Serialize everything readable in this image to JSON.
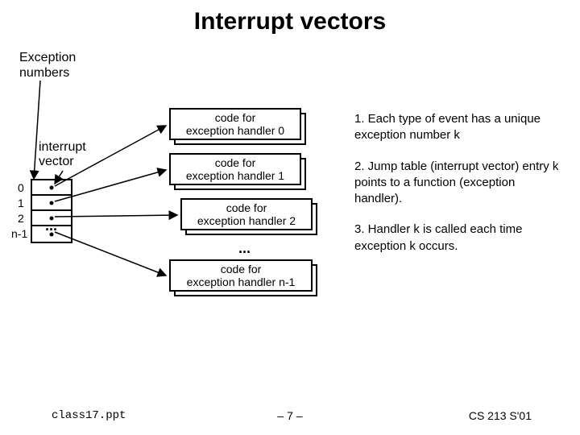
{
  "title": "Interrupt vectors",
  "subtitle": "Exception\nnumbers",
  "vector_label": "interrupt\nvector",
  "indices": [
    "0",
    "1",
    "2",
    "n-1"
  ],
  "vector_ellipsis": "...",
  "handlers": [
    "code for\nexception handler 0",
    "code for\nexception handler 1",
    "code for\nexception handler 2",
    "code for\nexception handler n-1"
  ],
  "handlers_ellipsis": "...",
  "notes": [
    "1. Each type of event has a unique exception number k",
    "2. Jump table (interrupt vector) entry k points to a function (exception handler).",
    "3. Handler k is called each time exception k occurs."
  ],
  "footer": {
    "left": "class17.ppt",
    "center": "– 7 –",
    "right": "CS 213 S'01"
  }
}
